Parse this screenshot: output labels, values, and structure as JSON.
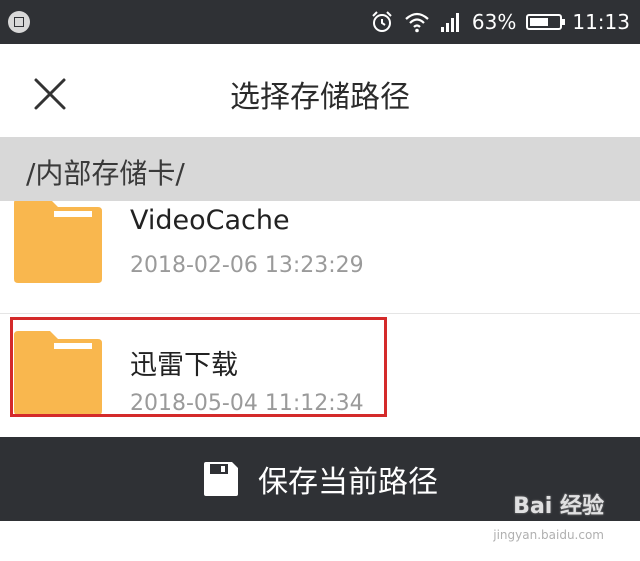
{
  "status_bar": {
    "battery_percent": "63%",
    "battery_level": 0.63,
    "time": "11:13",
    "icons": [
      "app-notification-icon",
      "alarm-icon",
      "wifi-icon",
      "signal-icon",
      "battery-icon"
    ]
  },
  "header": {
    "title": "选择存储路径",
    "close_icon": "close-icon"
  },
  "path_bar": {
    "path": "/内部存储卡/"
  },
  "files": [
    {
      "name": "VideoCache",
      "date": "2018-02-06 13:23:29",
      "icon": "folder-icon"
    },
    {
      "name": "迅雷下载",
      "date": "2018-05-04 11:12:34",
      "icon": "folder-icon",
      "highlighted": true
    }
  ],
  "save_button": {
    "label": "保存当前路径",
    "icon": "floppy-disk-icon"
  },
  "watermark": {
    "brand": "Bai 经验",
    "url": "jingyan.baidu.com"
  },
  "colors": {
    "status_bar_bg": "#2f3135",
    "path_bar_bg": "#d8d8d8",
    "folder": "#f9b74e",
    "highlight_border": "#d42a2a",
    "button_bg": "#2f3135"
  }
}
